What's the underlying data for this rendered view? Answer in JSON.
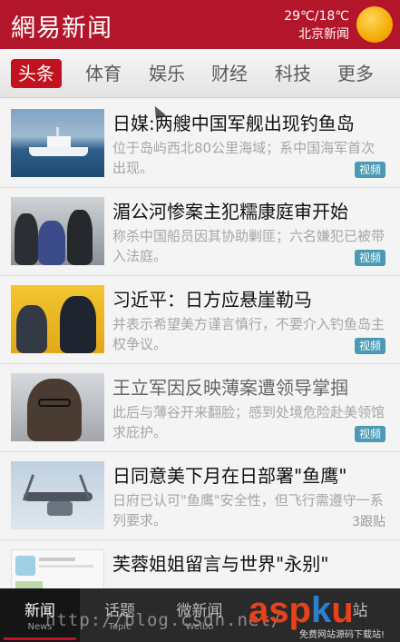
{
  "header": {
    "logo": "網易新闻",
    "temperature": "29℃/18℃",
    "city": "北京新闻",
    "weather_icon": "sun-icon"
  },
  "tabs": [
    "头条",
    "体育",
    "娱乐",
    "财经",
    "科技",
    "更多"
  ],
  "active_tab": "头条",
  "news": [
    {
      "title": "日媒:两艘中国军舰出现钓鱼岛",
      "summary": "位于岛屿西北80公里海域；系中国海军首次出现。",
      "badge": "视频",
      "follow": ""
    },
    {
      "title": "湄公河惨案主犯糯康庭审开始",
      "summary": "称杀中国船员因其协助剿匪；六名嫌犯已被带入法庭。",
      "badge": "视频",
      "follow": ""
    },
    {
      "title": "习近平：日方应悬崖勒马",
      "summary": "并表示希望美方谨言慎行，不要介入钓鱼岛主权争议。",
      "badge": "视频",
      "follow": ""
    },
    {
      "title": "王立军因反映薄案遭领导掌掴",
      "summary": "此后与薄谷开来翻脸；感到处境危险赴美领馆求庇护。",
      "badge": "视频",
      "follow": ""
    },
    {
      "title": "日同意美下月在日部署\"鱼鹰\"",
      "summary": "日府已认可\"鱼鹰\"安全性，但飞行需遵守一系列要求。",
      "badge": "",
      "follow": "3跟贴"
    },
    {
      "title": "芙蓉姐姐留言与世界\"永别\"",
      "summary": "",
      "badge": "",
      "follow": ""
    }
  ],
  "bottom_nav": [
    {
      "label": "新闻",
      "sub": "News"
    },
    {
      "label": "话题",
      "sub": "Topic"
    },
    {
      "label": "微新闻",
      "sub": "Weibo"
    },
    {
      "label": "",
      "sub": ""
    },
    {
      "label": "站",
      "sub": ""
    }
  ],
  "watermark": {
    "url": "http://blog.csdn.net/",
    "logo_a": "asp",
    "logo_b": "k",
    "logo_c": "u",
    "logo_sub": "免费网站源码下载站!"
  }
}
